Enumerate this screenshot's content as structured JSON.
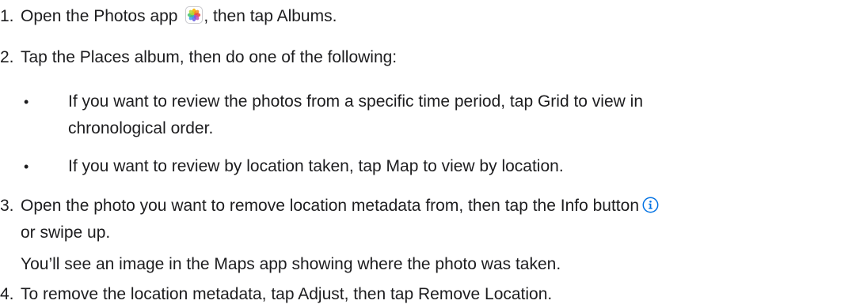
{
  "steps": [
    {
      "number": "1.",
      "text_before_icon": "Open the Photos app ",
      "icon": "photos-app-icon",
      "text_after_icon": ", then tap Albums."
    },
    {
      "number": "2.",
      "text": "Tap the Places album, then do one of the following:",
      "bullets": [
        {
          "line1": "If you want to review the photos from a specific time period, tap Grid to view in",
          "line2": "chronological order."
        },
        {
          "line1": "If you want to review by location taken, tap Map to view by location."
        }
      ]
    },
    {
      "number": "3.",
      "line1_text": "Open the photo you want to remove location metadata from, then tap the Info button",
      "icon": "info-circle-icon",
      "line2_text": "or swipe up.",
      "note": "You’ll see an image in the Maps app showing where the photo was taken."
    },
    {
      "number": "4.",
      "text": "To remove the location metadata, tap Adjust, then tap Remove Location."
    }
  ],
  "bullet_glyph": "•",
  "colors": {
    "text": "#1d1d1f",
    "info_icon": "#0071e3"
  }
}
